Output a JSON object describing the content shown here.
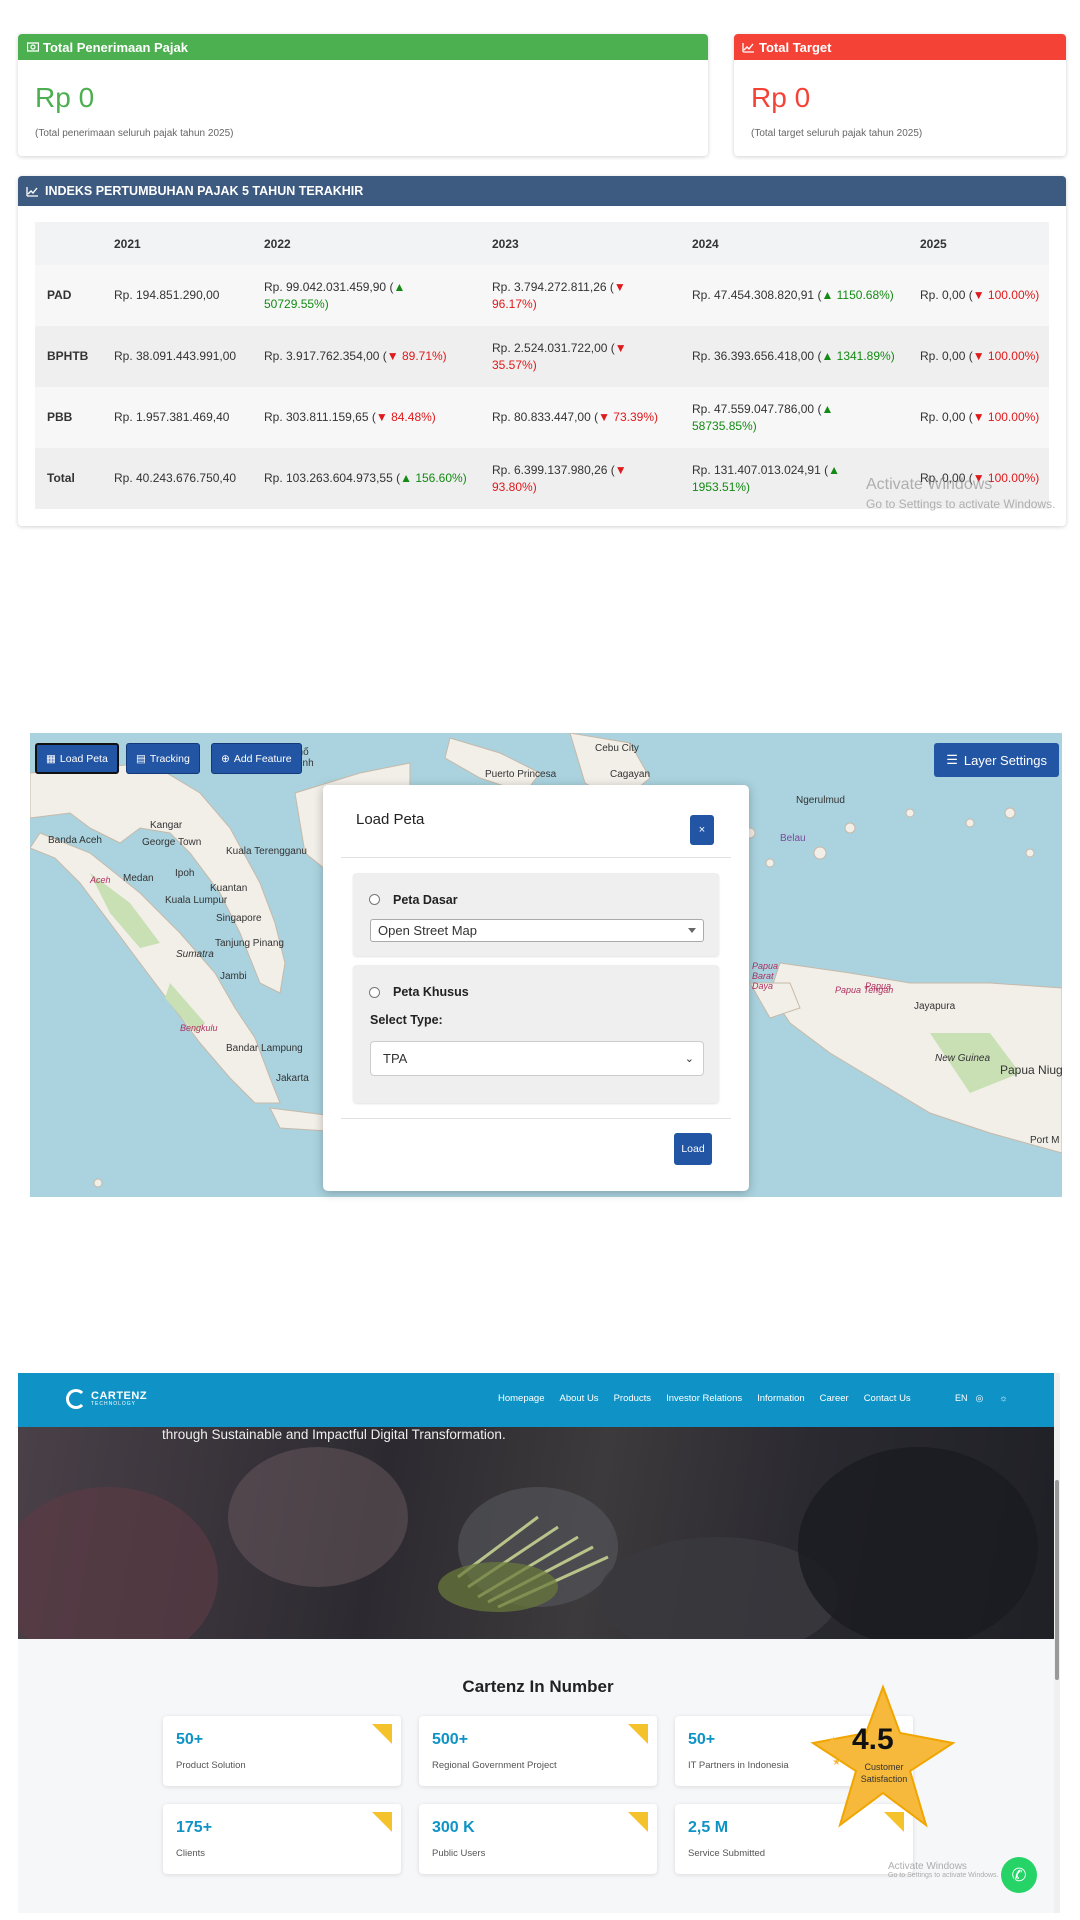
{
  "tax": {
    "receipt_card": {
      "title": "Total Penerimaan Pajak",
      "value": "Rp 0",
      "note": "(Total penerimaan seluruh pajak tahun 2025)",
      "color": "#4caf50"
    },
    "target_card": {
      "title": "Total Target",
      "value": "Rp 0",
      "note": "(Total target seluruh pajak tahun 2025)",
      "color": "#f44336"
    },
    "index": {
      "title": "INDEKS PERTUMBUHAN PAJAK 5 TAHUN TERAKHIR",
      "header_color": "#3d5a80",
      "columns": [
        "",
        "2021",
        "2022",
        "2023",
        "2024",
        "2025"
      ],
      "rows": [
        {
          "label": "PAD",
          "cells": [
            {
              "value": "Rp. 194.851.290,00",
              "change": ""
            },
            {
              "value": "Rp. 99.042.031.459,90 (",
              "change": "▲ 50729.55%)",
              "dir": "up"
            },
            {
              "value": "Rp. 3.794.272.811,26 (",
              "change": "▼ 96.17%)",
              "dir": "down"
            },
            {
              "value": "Rp. 47.454.308.820,91 (",
              "change": "▲ 1150.68%)",
              "dir": "up"
            },
            {
              "value": "Rp. 0,00 (",
              "change": "▼ 100.00%)",
              "dir": "down"
            }
          ]
        },
        {
          "label": "BPHTB",
          "cells": [
            {
              "value": "Rp. 38.091.443.991,00",
              "change": ""
            },
            {
              "value": "Rp. 3.917.762.354,00 (",
              "change": "▼ 89.71%)",
              "dir": "down"
            },
            {
              "value": "Rp. 2.524.031.722,00 (",
              "change": "▼ 35.57%)",
              "dir": "down"
            },
            {
              "value": "Rp. 36.393.656.418,00 (",
              "change": "▲ 1341.89%)",
              "dir": "up"
            },
            {
              "value": "Rp. 0,00 (",
              "change": "▼ 100.00%)",
              "dir": "down"
            }
          ]
        },
        {
          "label": "PBB",
          "cells": [
            {
              "value": "Rp. 1.957.381.469,40",
              "change": ""
            },
            {
              "value": "Rp. 303.811.159,65 (",
              "change": "▼ 84.48%)",
              "dir": "down"
            },
            {
              "value": "Rp. 80.833.447,00 (",
              "change": "▼ 73.39%)",
              "dir": "down"
            },
            {
              "value": "Rp. 47.559.047.786,00 (",
              "change": "▲ 58735.85%)",
              "dir": "up"
            },
            {
              "value": "Rp. 0,00 (",
              "change": "▼ 100.00%)",
              "dir": "down"
            }
          ]
        },
        {
          "label": "Total",
          "cells": [
            {
              "value": "Rp. 40.243.676.750,40",
              "change": ""
            },
            {
              "value": "Rp. 103.263.604.973,55 (",
              "change": "▲ 156.60%)",
              "dir": "up"
            },
            {
              "value": "Rp. 6.399.137.980,26 (",
              "change": "▼ 93.80%)",
              "dir": "down"
            },
            {
              "value": "Rp. 131.407.013.024,91 (",
              "change": "▲ 1953.51%)",
              "dir": "up"
            },
            {
              "value": "Rp. 0,00 (",
              "change": "▼ 100.00%)",
              "dir": "down"
            }
          ]
        }
      ]
    },
    "watermark": {
      "title": "Activate Windows",
      "sub": "Go to Settings to activate Windows."
    }
  },
  "map": {
    "buttons": {
      "load_peta": "Load Peta",
      "tracking": "Tracking",
      "add_feature": "Add Feature",
      "layer_settings": "Layer Settings"
    },
    "labels": [
      "Cebu City",
      "Puerto Princesa",
      "Cagayan",
      "Ngerulmud",
      "Belau",
      "Kangar",
      "Banda Aceh",
      "George Town",
      "Kuala Terengganu",
      "Medan",
      "Ipoh",
      "Aceh",
      "Kuantan",
      "Kuala Lumpur",
      "Singapore",
      "Tanjung Pinang",
      "Sumatra",
      "Jambi",
      "Bengkulu",
      "Bandar Lampung",
      "Jakarta",
      "Jayapura",
      "New Guinea",
      "Papua Niug",
      "Papua Tengah",
      "Papua Barat Daya",
      "Papua",
      "Port M",
      "phố Minh"
    ],
    "modal": {
      "title": "Load Peta",
      "close": "×",
      "base_map_label": "Peta Dasar",
      "base_map_value": "Open Street Map",
      "special_map_label": "Peta Khusus",
      "select_type_label": "Select Type:",
      "select_type_value": "TPA",
      "load": "Load"
    }
  },
  "cartenz": {
    "logo": {
      "name": "CARTENZ",
      "tag": "TECHNOLOGY"
    },
    "nav": [
      "Homepage",
      "About Us",
      "Products",
      "Investor Relations",
      "Information",
      "Career",
      "Contact Us"
    ],
    "lang": "EN",
    "hero_text": "through Sustainable and Impactful Digital Transformation.",
    "section_title": "Cartenz In Number",
    "stats": [
      {
        "value": "50+",
        "label": "Product Solution"
      },
      {
        "value": "500+",
        "label": "Regional Government Project"
      },
      {
        "value": "50+",
        "label": "IT Partners in Indonesia"
      },
      {
        "value": "175+",
        "label": "Clients"
      },
      {
        "value": "300 K",
        "label": "Public Users"
      },
      {
        "value": "2,5 M",
        "label": "Service Submitted"
      }
    ],
    "rating": {
      "value": "4.5",
      "label": "Customer Satisfaction"
    },
    "watermark": {
      "title": "Activate Windows",
      "sub": "Go to Settings to activate Windows."
    }
  }
}
